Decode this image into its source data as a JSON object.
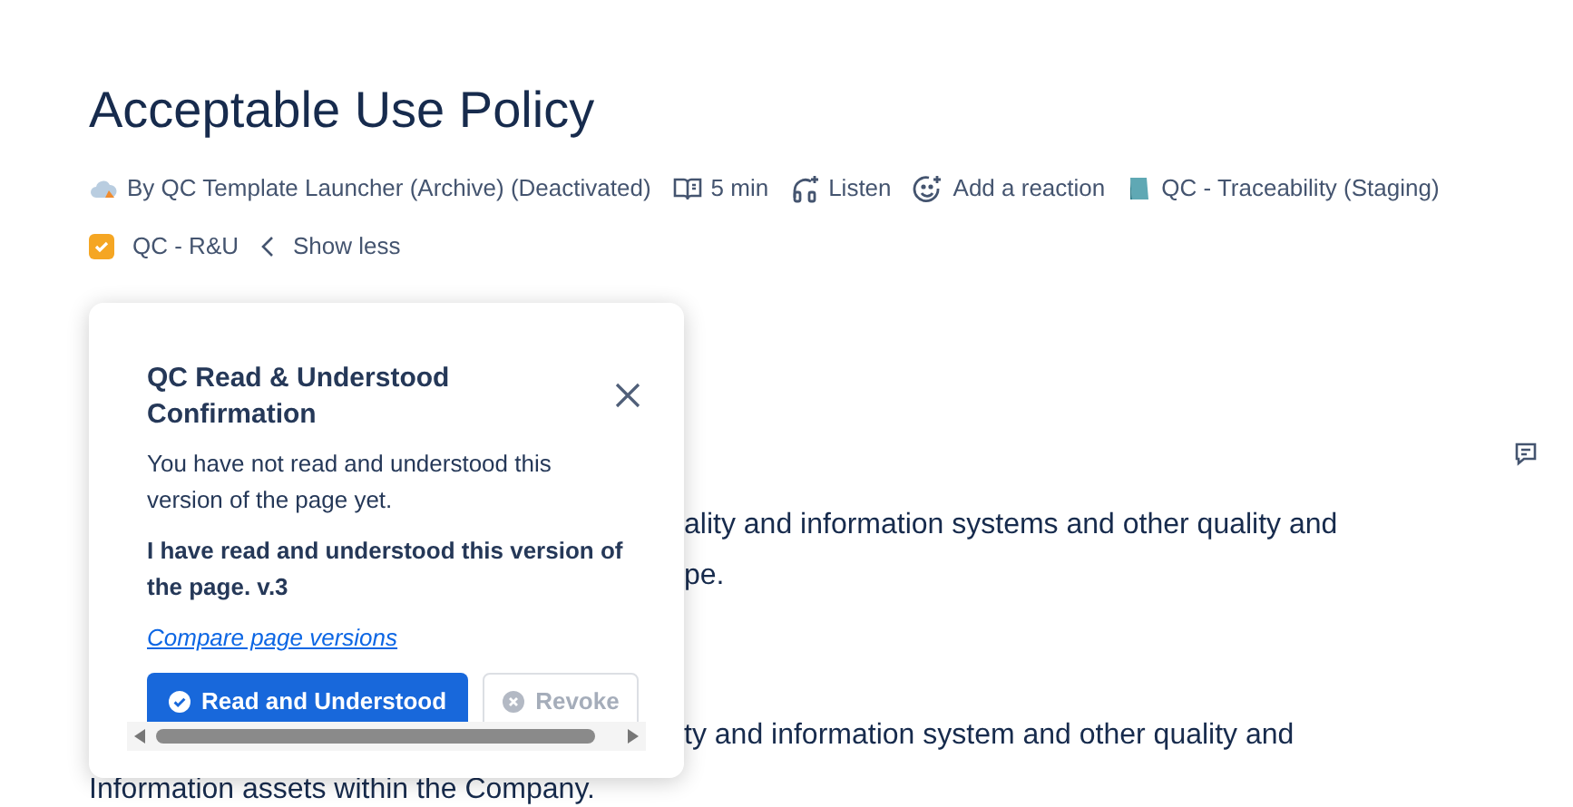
{
  "page": {
    "title": "Acceptable Use Policy",
    "byline": [
      {
        "kind": "author",
        "text": "By QC Template Launcher (Archive) (Deactivated)"
      },
      {
        "kind": "read_time",
        "text": "5 min"
      },
      {
        "kind": "listen",
        "text": "Listen"
      },
      {
        "kind": "reaction",
        "text": "Add a reaction"
      },
      {
        "kind": "space",
        "text": "QC - Traceability (Staging)"
      }
    ],
    "byline_2": [
      {
        "kind": "app",
        "text": "QC - R&U"
      },
      {
        "kind": "toggle",
        "text": "Show less"
      }
    ],
    "body_lines": [
      "ality and information systems and other quality and",
      "pe.",
      "ty and information system and other quality and",
      "Information assets within the Company."
    ]
  },
  "popup": {
    "title": "QC Read & Understood Confirmation",
    "status": "You have not read and understood this version of the page yet.",
    "statement": "I have read and understood this version of the page. v.3",
    "link": "Compare page versions",
    "buttons": [
      {
        "kind": "primary",
        "label": "Read and Understood",
        "disabled": false
      },
      {
        "kind": "secondary",
        "label": "Revoke",
        "disabled": true
      }
    ]
  }
}
